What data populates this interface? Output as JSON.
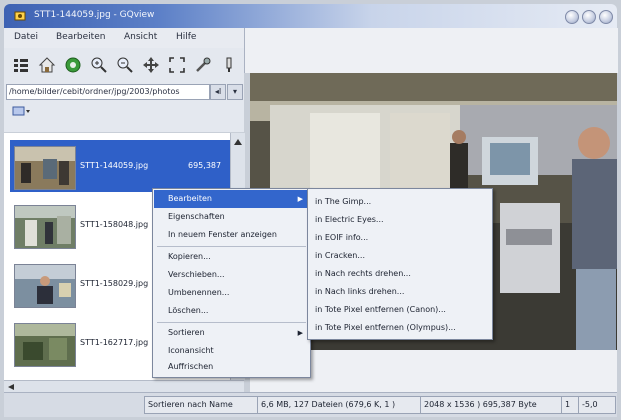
{
  "window": {
    "title": "STT1-144059.jpg - GQview",
    "controls": [
      "minimize-icon",
      "maximize-icon",
      "close-icon"
    ]
  },
  "menubar": [
    "Datei",
    "Bearbeiten",
    "Ansicht",
    "Hilfe"
  ],
  "toolbar": {
    "icons": [
      "thumbnails-icon",
      "home-icon",
      "refresh-icon",
      "zoom-in-icon",
      "zoom-out-icon",
      "zoom-fit-icon",
      "fullscreen-icon",
      "tools-icon",
      "config-icon"
    ]
  },
  "path": {
    "value": "/home/bilder/cebit/ordner/jpg/2003/photos",
    "back_label": "◂I",
    "menu_label": "▾"
  },
  "files": [
    {
      "name": "STT1-144059.jpg",
      "size": "695,387",
      "selected": true
    },
    {
      "name": "STT1-158048.jpg",
      "size": "",
      "selected": false
    },
    {
      "name": "STT1-158029.jpg",
      "size": "",
      "selected": false
    },
    {
      "name": "STT1-162717.jpg",
      "size": "",
      "selected": false
    }
  ],
  "context_menu": {
    "items": [
      {
        "label": "Bearbeiten",
        "submenu": true,
        "highlighted": true
      },
      {
        "label": "Eigenschaften"
      },
      {
        "label": "In neuem Fenster anzeigen"
      },
      {
        "label": "Kopieren..."
      },
      {
        "label": "Verschieben..."
      },
      {
        "label": "Umbenennen..."
      },
      {
        "label": "Löschen..."
      },
      {
        "label": "Sortieren",
        "submenu": true
      },
      {
        "label": "Iconansicht"
      },
      {
        "label": "Auffrischen"
      }
    ]
  },
  "submenu": {
    "items": [
      "in The Gimp...",
      "in Electric Eyes...",
      "in EOIF info...",
      "in Cracken...",
      "in Nach rechts drehen...",
      "in Nach links drehen...",
      "in Tote Pixel entfernen (Canon)...",
      "in Tote Pixel entfernen (Olympus)..."
    ]
  },
  "statusbar": {
    "sort": "Sortieren nach Name",
    "info": "6,6 MB, 127 Dateien (679,6 K, 1 )",
    "dims": "2048 x 1536 ) 695,387 Byte",
    "page": "1",
    "zoom": "-5,0"
  },
  "colors": {
    "selection": "#2f60c8",
    "menu_highlight": "#3366cc",
    "titlebar": "#3e62b3"
  }
}
